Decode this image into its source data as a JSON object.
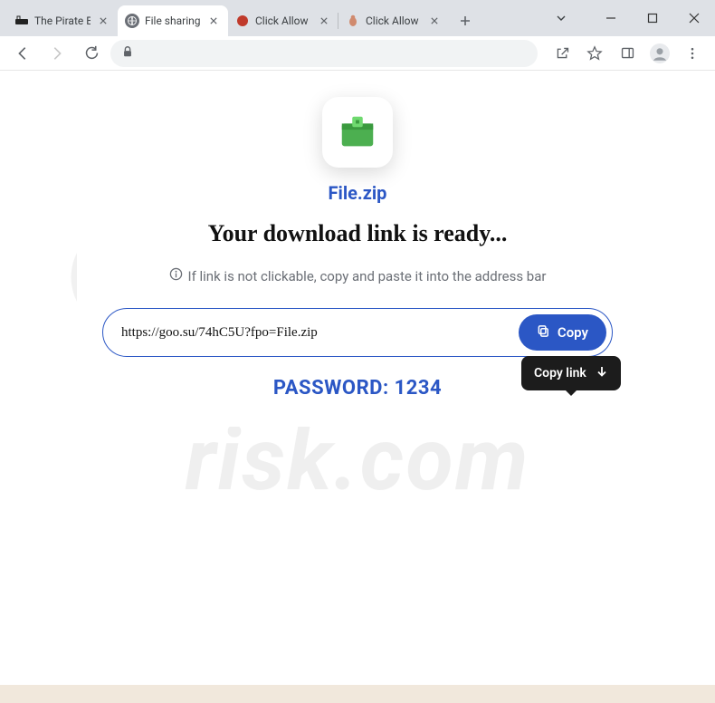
{
  "tabs": [
    {
      "title": "The Pirate Bay",
      "favicon": "pirate"
    },
    {
      "title": "File sharing se",
      "favicon": "globe"
    },
    {
      "title": "Click Allow",
      "favicon": "red-dot"
    },
    {
      "title": "Click Allow if y",
      "favicon": "bug"
    }
  ],
  "content": {
    "file_name": "File.zip",
    "headline": "Your download link is ready...",
    "hint": "If link is not clickable, copy and paste it into the address bar",
    "url": "https://goo.su/74hC5U?fpo=File.zip",
    "copy_label": "Copy",
    "tooltip": "Copy link",
    "password_label": "PASSWORD: 1234"
  }
}
